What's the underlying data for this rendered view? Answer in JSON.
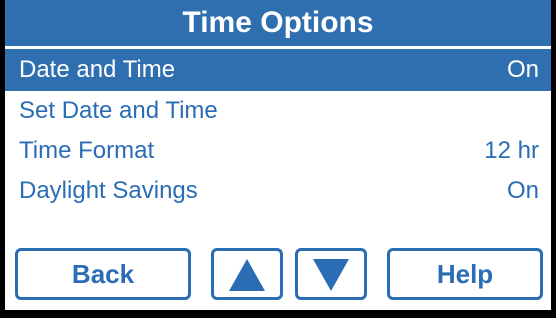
{
  "title": "Time Options",
  "menu": {
    "items": [
      {
        "label": "Date and Time",
        "value": "On",
        "selected": true
      },
      {
        "label": "Set Date and Time",
        "value": ""
      },
      {
        "label": "Time Format",
        "value": "12 hr"
      },
      {
        "label": "Daylight Savings",
        "value": "On"
      }
    ]
  },
  "buttons": {
    "back_label": "Back",
    "up_icon": "up-triangle-icon",
    "down_icon": "down-triangle-icon",
    "help_label": "Help"
  },
  "colors": {
    "accent": "#2f6fb0",
    "text_blue": "#2a6db5",
    "frame": "#000000"
  }
}
